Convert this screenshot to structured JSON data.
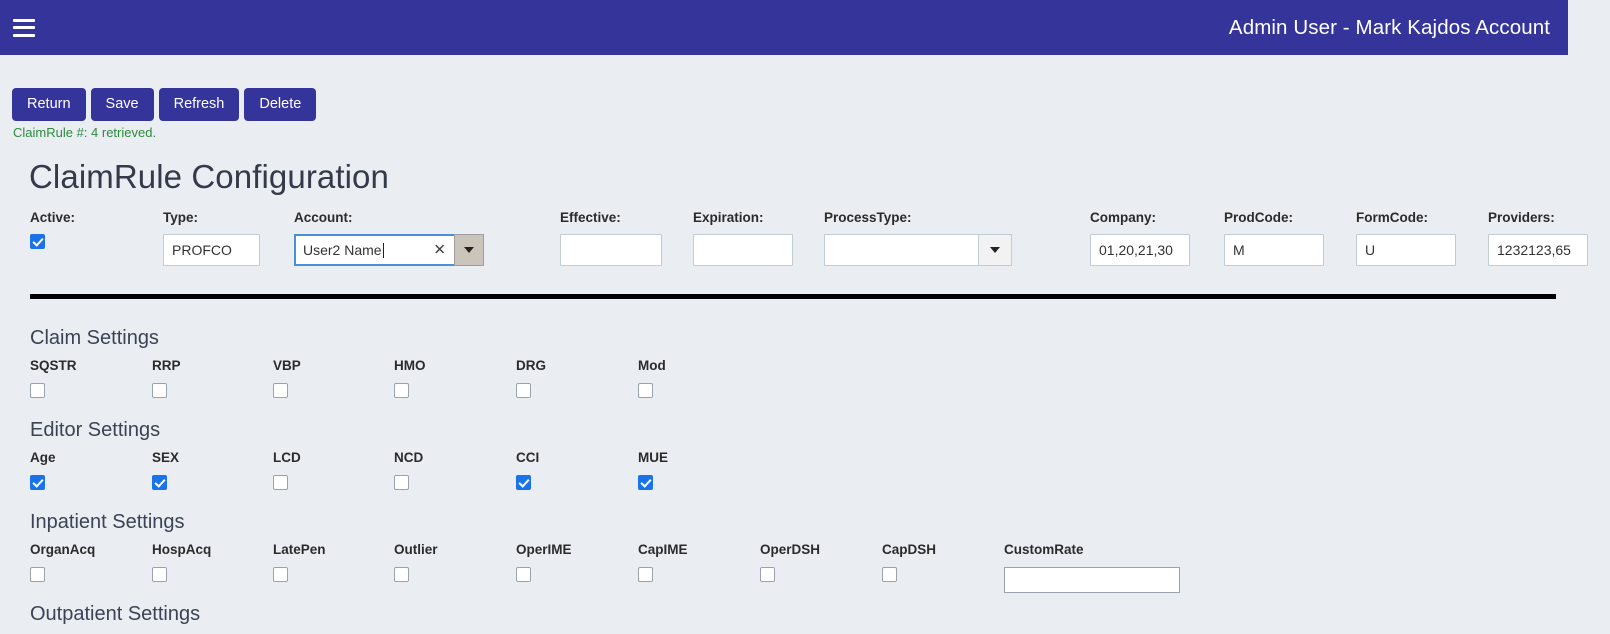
{
  "topbar": {
    "menu_icon": "hamburger-icon",
    "title": "Admin User - Mark Kajdos Account",
    "bg_color": "#34349b"
  },
  "toolbar": {
    "buttons": [
      {
        "label": "Return"
      },
      {
        "label": "Save"
      },
      {
        "label": "Refresh"
      },
      {
        "label": "Delete"
      }
    ]
  },
  "status": {
    "message": "ClaimRule #: 4 retrieved.",
    "color": "#2e8b3d"
  },
  "page": {
    "title": "ClaimRule Configuration",
    "background": "#eaedf2"
  },
  "fields": {
    "active": {
      "label": "Active:",
      "checked": true
    },
    "type": {
      "label": "Type:",
      "value": "PROFCO"
    },
    "account": {
      "label": "Account:",
      "value": "User2 Name",
      "clear_icon": "close-icon",
      "dropdown_icon": "chevron-down-icon",
      "focused": true
    },
    "effective": {
      "label": "Effective:",
      "value": ""
    },
    "expiration": {
      "label": "Expiration:",
      "value": ""
    },
    "process_type": {
      "label": "ProcessType:",
      "value": "",
      "dropdown_icon": "chevron-down-icon"
    },
    "company": {
      "label": "Company:",
      "value": "01,20,21,30"
    },
    "prod_code": {
      "label": "ProdCode:",
      "value": "M"
    },
    "form_code": {
      "label": "FormCode:",
      "value": "U"
    },
    "providers": {
      "label": "Providers:",
      "value": "1232123,65"
    }
  },
  "sections": [
    {
      "title": "Claim Settings",
      "checkboxes": [
        {
          "label": "SQSTR",
          "checked": false
        },
        {
          "label": "RRP",
          "checked": false
        },
        {
          "label": "VBP",
          "checked": false
        },
        {
          "label": "HMO",
          "checked": false
        },
        {
          "label": "DRG",
          "checked": false
        },
        {
          "label": "Mod",
          "checked": false
        }
      ]
    },
    {
      "title": "Editor Settings",
      "checkboxes": [
        {
          "label": "Age",
          "checked": true
        },
        {
          "label": "SEX",
          "checked": true
        },
        {
          "label": "LCD",
          "checked": false
        },
        {
          "label": "NCD",
          "checked": false
        },
        {
          "label": "CCI",
          "checked": true
        },
        {
          "label": "MUE",
          "checked": true
        }
      ]
    },
    {
      "title": "Inpatient Settings",
      "checkboxes": [
        {
          "label": "OrganAcq",
          "checked": false
        },
        {
          "label": "HospAcq",
          "checked": false
        },
        {
          "label": "LatePen",
          "checked": false
        },
        {
          "label": "Outlier",
          "checked": false
        },
        {
          "label": "OperIME",
          "checked": false
        },
        {
          "label": "CapIME",
          "checked": false
        },
        {
          "label": "OperDSH",
          "checked": false
        },
        {
          "label": "CapDSH",
          "checked": false
        }
      ],
      "custom_rate": {
        "label": "CustomRate",
        "value": ""
      }
    }
  ],
  "clipped_section": {
    "title": "Outpatient Settings"
  },
  "colors": {
    "brand": "#34349b",
    "accent_checkbox": "#1a73e8",
    "status_green": "#2e8b3d",
    "page_bg": "#eaedf2"
  }
}
